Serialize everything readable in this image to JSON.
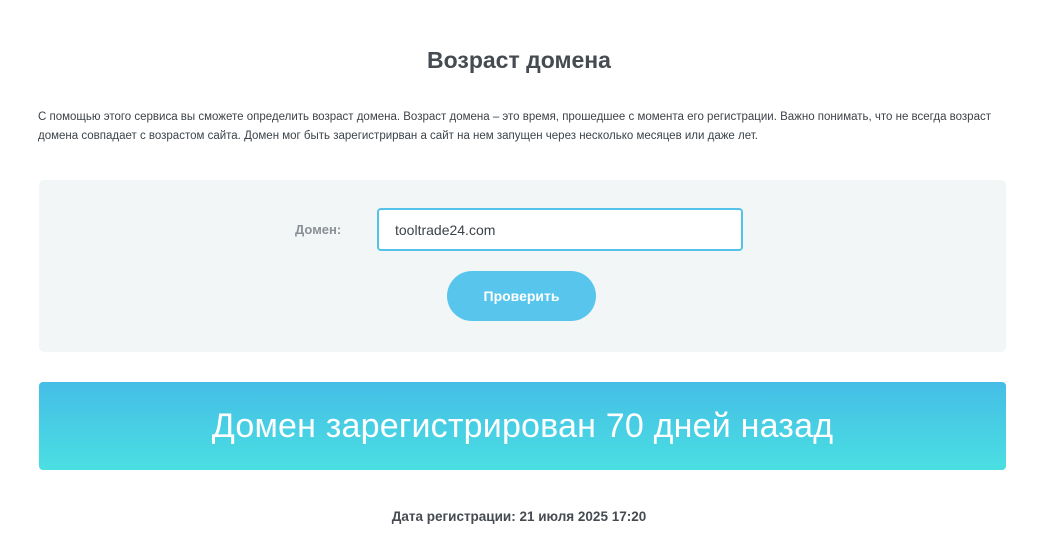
{
  "header": {
    "title": "Возраст домена"
  },
  "intro": {
    "text": "С помощью этого сервиса вы сможете определить возраст домена. Возраст домена – это время, прошедшее с момента его регистрации. Важно понимать, что не всегда возраст домена совпадает с возрастом сайта. Домен мог быть зарегистрирван а сайт на нем запущен через несколько месяцев или даже лет."
  },
  "form": {
    "domain_label": "Домен:",
    "domain_value": "tooltrade24.com",
    "check_button_label": "Проверить"
  },
  "result": {
    "banner_text": "Домен зарегистрирован 70 дней назад",
    "registration_date": "Дата регистрации: 21 июля 2025 17:20"
  },
  "colors": {
    "accent": "#58c5ec",
    "input_border": "#55c2e9",
    "panel_background": "#f3f6f7",
    "banner_gradient_top": "#45bde6",
    "banner_gradient_bottom": "#4adfe2"
  }
}
